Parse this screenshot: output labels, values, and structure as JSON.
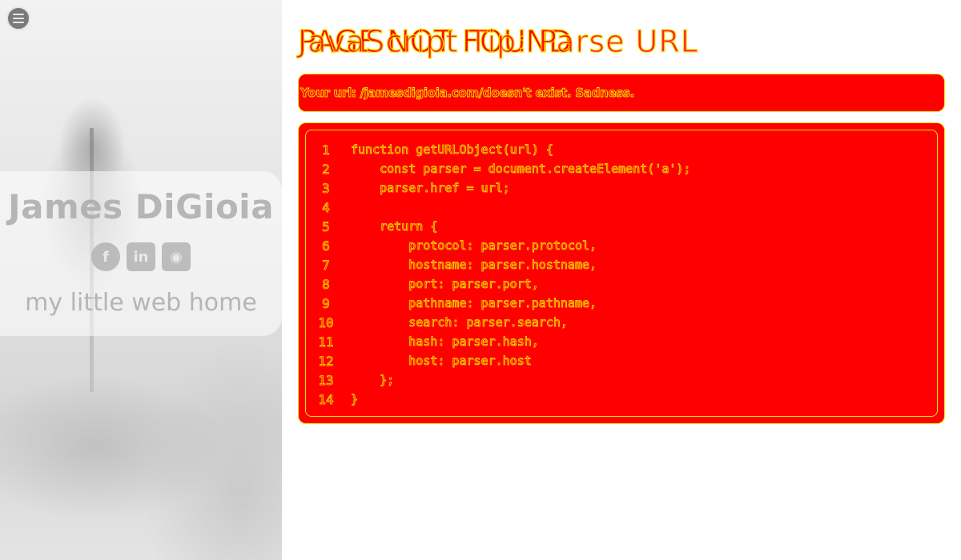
{
  "sidebar": {
    "menu_icon": "hamburger-menu-icon",
    "name": "James DiGioia",
    "social": [
      {
        "icon": "facebook-icon",
        "glyph": "f"
      },
      {
        "icon": "linkedin-icon",
        "glyph": "in"
      },
      {
        "icon": "github-icon",
        "glyph": "◉"
      }
    ],
    "tagline": "my little web home"
  },
  "main": {
    "title": "PAGE NOT FOUND",
    "title_overlay": "JavaScript Tip: Parse URL",
    "error_message": "Your url: /jamesdigioia.com/doesn't exist.  Sadness.",
    "code": {
      "line_numbers": [
        "1",
        "2",
        "3",
        "4",
        "5",
        "6",
        "7",
        "8",
        "9",
        "10",
        "11",
        "12",
        "13",
        "14"
      ],
      "lines": [
        "function getURLObject(url) {",
        "    const parser = document.createElement('a');",
        "    parser.href = url;",
        "",
        "    return {",
        "        protocol: parser.protocol,",
        "        hostname: parser.hostname,",
        "        port: parser.port,",
        "        pathname: parser.pathname,",
        "        search: parser.search,",
        "        hash: parser.hash,",
        "        host: parser.host",
        "    };",
        "}"
      ]
    }
  },
  "colors": {
    "accent": "#ff0000",
    "outline": "#f5e600"
  }
}
